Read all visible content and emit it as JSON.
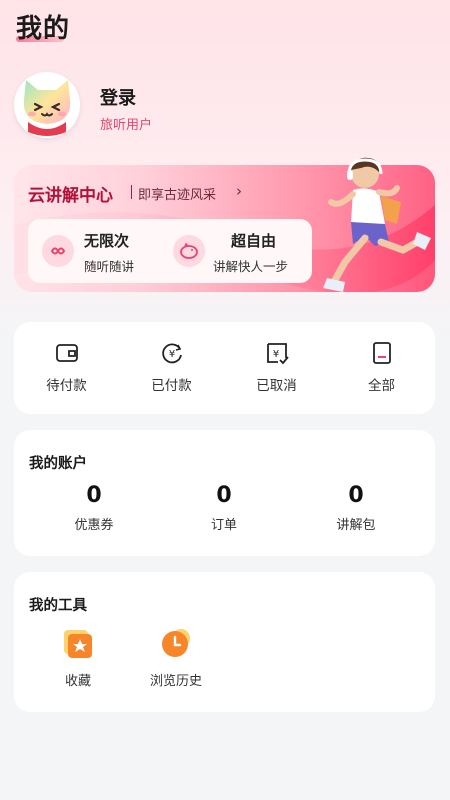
{
  "header": {
    "title": "我的"
  },
  "profile": {
    "login_label": "登录",
    "user_type": "旅听用户"
  },
  "banner": {
    "title": "云讲解中心",
    "subtitle": "即享古迹风采",
    "features": [
      {
        "title": "无限次",
        "subtitle": "随听随讲",
        "icon": "infinity-icon"
      },
      {
        "title": "超自由",
        "subtitle": "讲解快人一步",
        "icon": "piggy-bank-icon"
      }
    ]
  },
  "orders": {
    "items": [
      {
        "label": "待付款",
        "icon": "wallet-icon"
      },
      {
        "label": "已付款",
        "icon": "yuan-refresh-icon"
      },
      {
        "label": "已取消",
        "icon": "yuan-check-icon"
      },
      {
        "label": "全部",
        "icon": "document-icon"
      }
    ]
  },
  "account": {
    "title": "我的账户",
    "stats": [
      {
        "value": "0",
        "label": "优惠券"
      },
      {
        "value": "0",
        "label": "订单"
      },
      {
        "value": "0",
        "label": "讲解包"
      }
    ]
  },
  "tools": {
    "title": "我的工具",
    "items": [
      {
        "label": "收藏",
        "icon": "star-folder-icon"
      },
      {
        "label": "浏览历史",
        "icon": "clock-history-icon"
      }
    ]
  },
  "colors": {
    "accent": "#e8456c",
    "banner_end": "#ff3f6a"
  }
}
